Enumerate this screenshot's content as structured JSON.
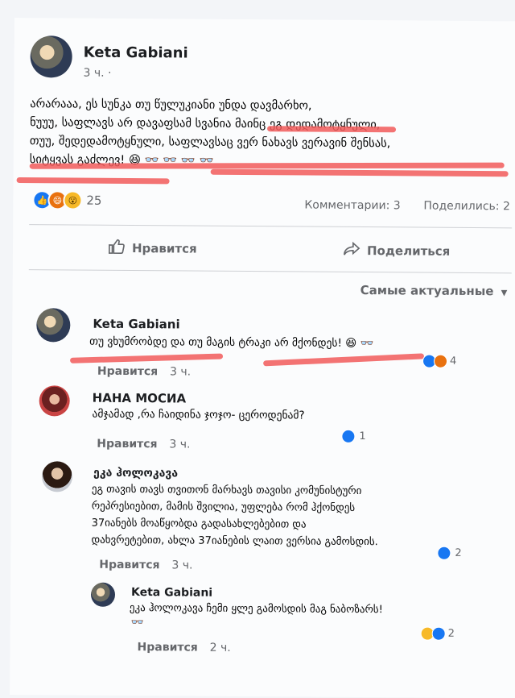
{
  "post": {
    "author": "Keta Gabiani",
    "time": "3 ч. ·",
    "text_lines": [
      "არარააა, ეს სუნკა თუ წულუკიანი უნდა დავმარხო,",
      "ნუუუ, საფლავს არ დავაფსამ სვანია მაინც ეგ დედამოტყნული,",
      "თუუ, შედედამოტყნული, საფლავსაც ვერ ნახავს ვერავინ შენსას,",
      "სიტყვას გაძლევ! 😆 👓 👓 👓 👓"
    ],
    "reaction_count": "25",
    "comments_link": "Комментарии: 3",
    "shares_link": "Поделились: 2",
    "like_label": "Нравится",
    "share_label": "Поделиться",
    "sort_label": "Самые актуальные"
  },
  "comments": [
    {
      "author": "Keta Gabiani",
      "text": "თუ ვხუმრობდე და თუ მაგის ტრაკი არ მქონდეს! 😆 👓",
      "react_count": "4",
      "like_label": "Нравится",
      "time": "3 ч."
    },
    {
      "author": "НАНА МОСИА",
      "text": "ამჯამად ,რა ჩაიდინა ჯოჯო- ცეროდენამ?",
      "react_count": "1",
      "like_label": "Нравится",
      "time": "3 ч."
    },
    {
      "author": "ეკა ჰოლოკავა",
      "text_lines": [
        "ეგ თავის თავს თვითონ მარხავს თავისი კომუნისტური",
        "რეპრესიებით, მამის შვილია, უფლება რომ ჰქონდეს",
        "37იანებს მოაწყობდა გადასახლებებით და",
        "დახვრეტებით, ახლა 37იანების ლაით ვერსია გამოსდის."
      ],
      "react_count": "2",
      "like_label": "Нравится",
      "time": "3 ч."
    }
  ],
  "reply": {
    "author": "Keta Gabiani",
    "text": "ეკა ჰოლოკავა ჩემი ყლე გამოსდის მაგ ნაბოზარს!",
    "emoji": "👓",
    "react_count": "2",
    "like_label": "Нравится",
    "time": "2 ч."
  },
  "colors": {
    "accent": "#1877f2",
    "highlight": "#f15a5a"
  }
}
